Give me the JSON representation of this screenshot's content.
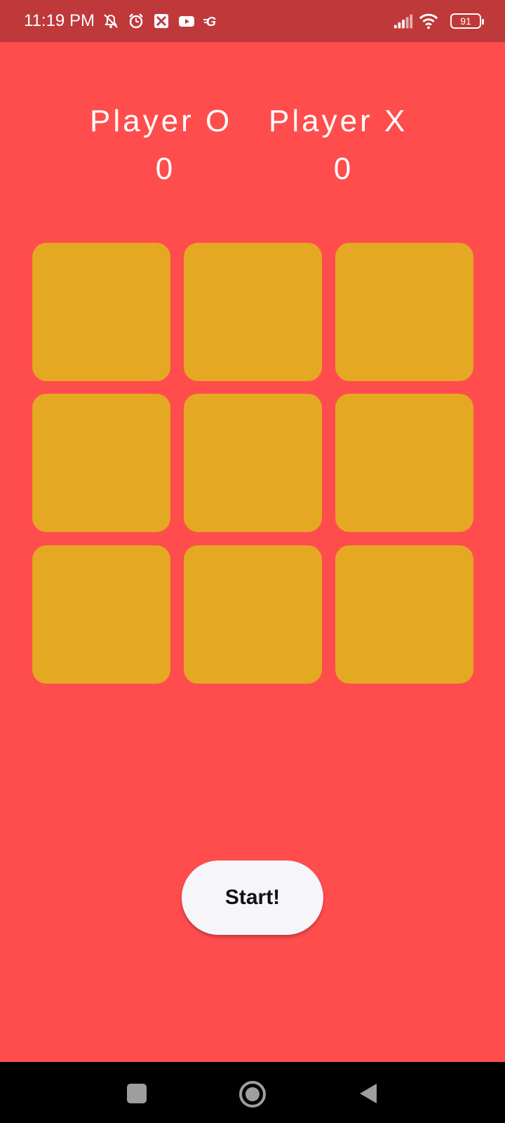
{
  "status_bar": {
    "time": "11:19 PM",
    "battery": "91",
    "icons": [
      "muted-alarm-icon",
      "alarm-icon",
      "app-icon",
      "youtube-icon",
      "g-app-icon",
      "signal-icon",
      "wifi-icon",
      "battery-icon"
    ]
  },
  "scores": {
    "player_o_label": "Player O",
    "player_x_label": "Player X",
    "player_o_score": "0",
    "player_x_score": "0"
  },
  "board": {
    "cells": [
      "",
      "",
      "",
      "",
      "",
      "",
      "",
      "",
      ""
    ],
    "cell_color": "#E5A823"
  },
  "actions": {
    "start_label": "Start!"
  },
  "navigation": {
    "icons": [
      "recents-icon",
      "home-icon",
      "back-icon"
    ]
  },
  "colors": {
    "background": "#FF4D4D",
    "status_bar": "#BF393B",
    "button": "#F5F5FA"
  }
}
